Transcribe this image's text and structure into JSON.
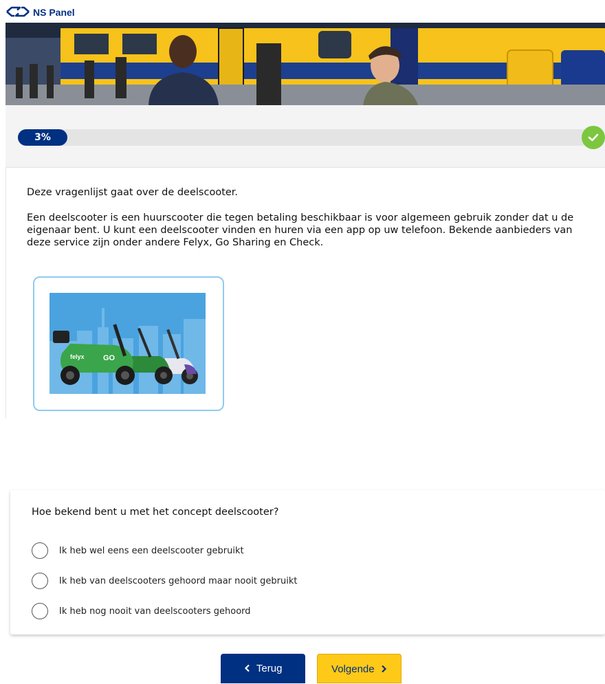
{
  "header": {
    "brand": "NS Panel",
    "logo_icon": "ns-logo-icon",
    "brand_color": "#003082"
  },
  "progress": {
    "percent": 3,
    "label": "3%",
    "complete_icon": "check-icon",
    "bar_color": "#003082",
    "check_color": "#7cc73f"
  },
  "intro": {
    "line1": "Deze vragenlijst gaat over de deelscooter.",
    "line2": "Een deelscooter is een huurscooter die tegen betaling beschikbaar is voor algemeen gebruik zonder dat u de eigenaar bent. U kunt een deelscooter vinden en huren via een app op uw telefoon. Bekende aanbieders van deze service zijn onder andere Felyx, Go Sharing en Check."
  },
  "image": {
    "scooter_labels": [
      "felyx",
      "GO"
    ]
  },
  "question": {
    "text": "Hoe bekend bent u met het concept deelscooter?",
    "options": [
      {
        "label": "Ik heb wel eens een deelscooter gebruikt",
        "selected": false
      },
      {
        "label": "Ik heb van deelscooters gehoord maar nooit gebruikt",
        "selected": false
      },
      {
        "label": "Ik heb nog nooit van deelscooters gehoord",
        "selected": false
      }
    ]
  },
  "nav": {
    "back_label": "Terug",
    "back_icon": "chevron-left-icon",
    "next_label": "Volgende",
    "next_icon": "chevron-right-icon",
    "back_color": "#003082",
    "next_color": "#ffc917"
  }
}
